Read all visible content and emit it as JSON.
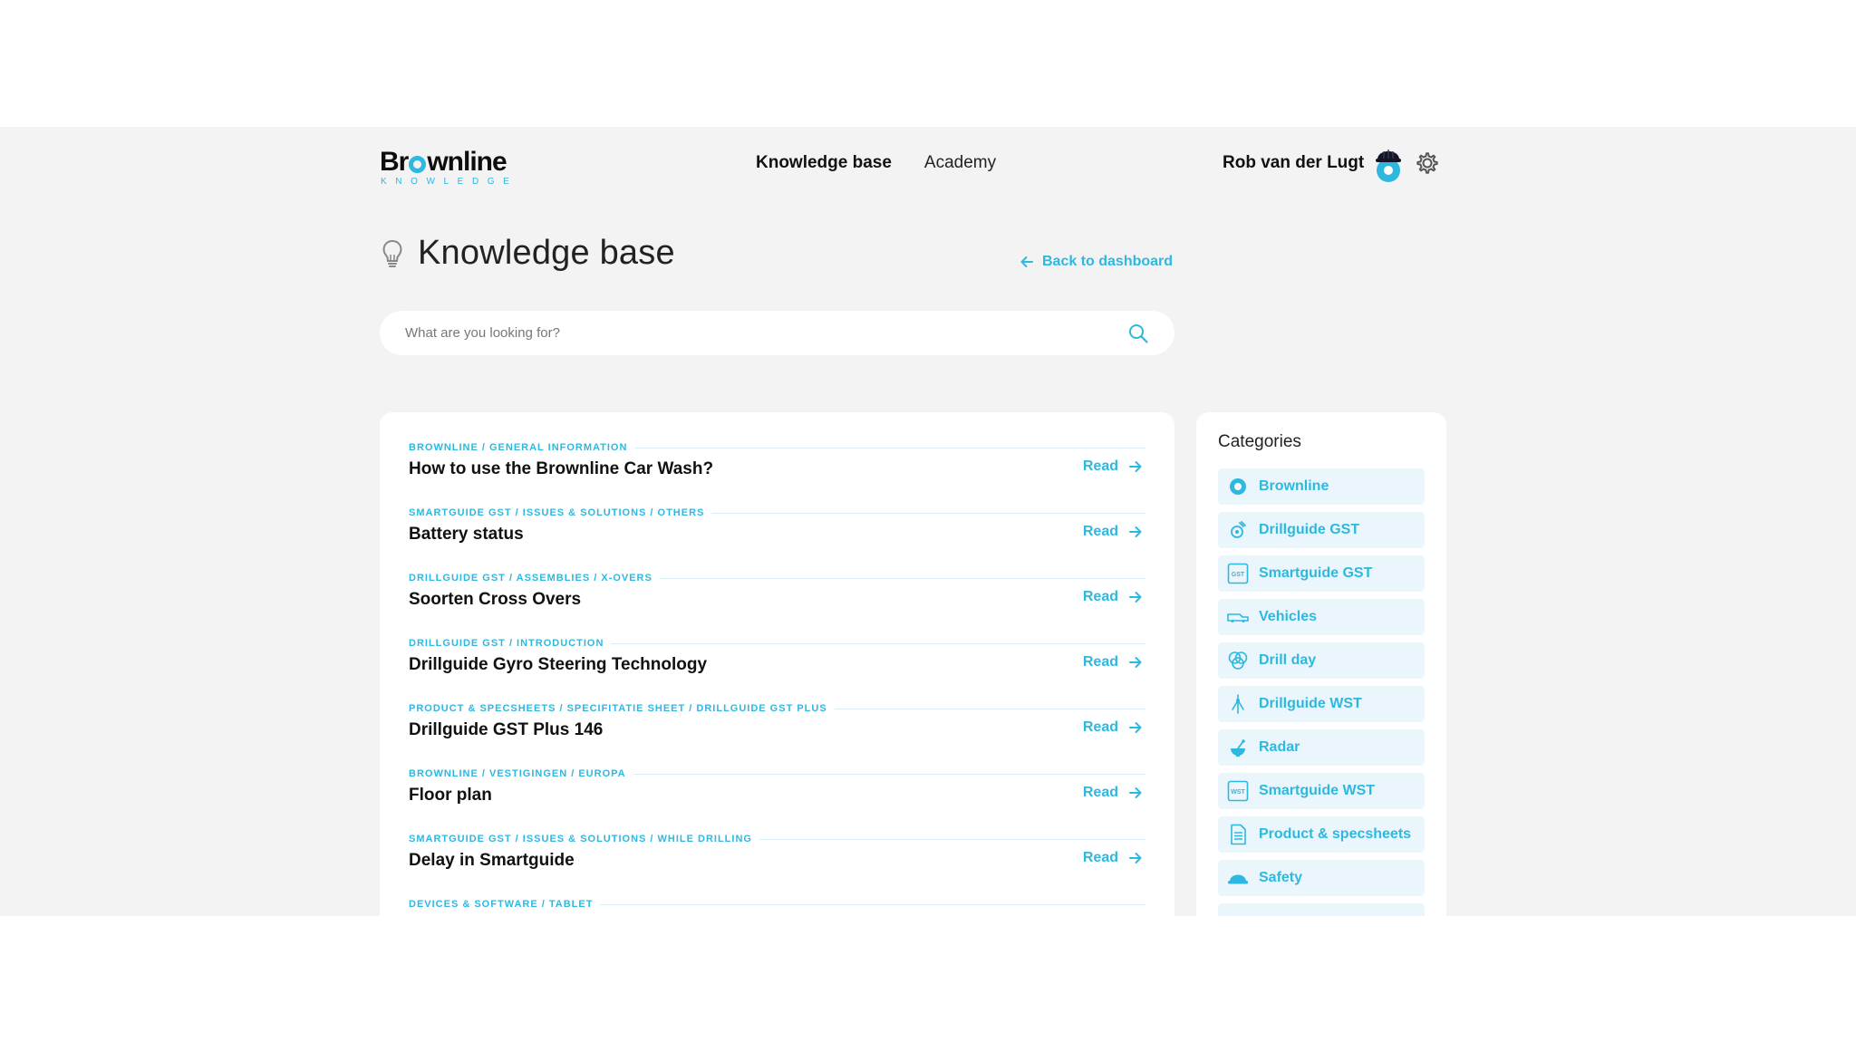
{
  "brand": {
    "name_left": "Br",
    "name_right": "wnline",
    "sub": "KNOWLEDGE",
    "accent": "#2eb8e0"
  },
  "nav": [
    {
      "label": "Knowledge base",
      "active": true
    },
    {
      "label": "Academy",
      "active": false
    }
  ],
  "user": {
    "name": "Rob van der Lugt"
  },
  "page": {
    "title": "Knowledge base",
    "back_label": "Back to dashboard"
  },
  "search": {
    "placeholder": "What are you looking for?",
    "value": ""
  },
  "articles": [
    {
      "crumb": "BROWNLINE / GENERAL INFORMATION",
      "title": "How to use the Brownline Car Wash?",
      "action": "Read"
    },
    {
      "crumb": "SMARTGUIDE GST / ISSUES & SOLUTIONS / OTHERS",
      "title": "Battery status",
      "action": "Read"
    },
    {
      "crumb": "DRILLGUIDE GST / ASSEMBLIES / X-OVERS",
      "title": "Soorten Cross Overs",
      "action": "Read"
    },
    {
      "crumb": "DRILLGUIDE GST / INTRODUCTION",
      "title": "Drillguide Gyro Steering Technology",
      "action": "Read"
    },
    {
      "crumb": "PRODUCT & SPECSHEETS / SPECIFITATIE SHEET / DRILLGUIDE GST PLUS",
      "title": "Drillguide GST Plus 146",
      "action": "Read"
    },
    {
      "crumb": "BROWNLINE / VESTIGINGEN / EUROPA",
      "title": "Floor plan",
      "action": "Read"
    },
    {
      "crumb": "SMARTGUIDE GST / ISSUES & SOLUTIONS / WHILE DRILLING",
      "title": "Delay in Smartguide",
      "action": "Read"
    },
    {
      "crumb": "DEVICES & SOFTWARE / TABLET",
      "title": "",
      "action": ""
    }
  ],
  "categories": {
    "title": "Categories",
    "items": [
      {
        "label": "Brownline",
        "icon": "brownline-ring-icon"
      },
      {
        "label": "Drillguide GST",
        "icon": "drillguide-gst-icon"
      },
      {
        "label": "Smartguide GST",
        "icon": "gst-box-icon",
        "badge": "GST"
      },
      {
        "label": "Vehicles",
        "icon": "vehicle-icon"
      },
      {
        "label": "Drill day",
        "icon": "drill-day-icon"
      },
      {
        "label": "Drillguide WST",
        "icon": "drillguide-wst-icon"
      },
      {
        "label": "Radar",
        "icon": "radar-icon"
      },
      {
        "label": "Smartguide WST",
        "icon": "wst-box-icon",
        "badge": "WST"
      },
      {
        "label": "Product & specsheets",
        "icon": "document-icon"
      },
      {
        "label": "Safety",
        "icon": "helmet-icon"
      },
      {
        "label": "",
        "icon": ""
      }
    ]
  }
}
